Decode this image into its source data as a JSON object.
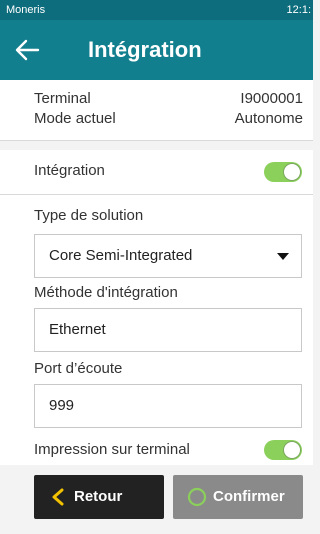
{
  "status_bar": {
    "app_name": "Moneris",
    "time": "12:1:"
  },
  "header": {
    "title": "Intégration",
    "back_icon": "arrow-left-icon"
  },
  "info": {
    "terminal_label": "Terminal",
    "terminal_value": "I9000001",
    "mode_label": "Mode actuel",
    "mode_value": "Autonome"
  },
  "integration_toggle": {
    "label": "Intégration",
    "on": true,
    "color": "#8bd05a"
  },
  "solution_type": {
    "label": "Type de solution",
    "value": "Core Semi-Integrated"
  },
  "integration_method": {
    "label": "Méthode d'intégration",
    "value": "Ethernet"
  },
  "listen_port": {
    "label": "Port d’écoute",
    "value": "999"
  },
  "print_toggle": {
    "label": "Impression sur terminal",
    "on": true
  },
  "buttons": {
    "back_label": "Retour",
    "back_icon": "chevron-left-icon",
    "confirm_label": "Confirmer",
    "confirm_icon": "circle-icon"
  },
  "colors": {
    "header": "#127f8e",
    "status": "#0e6d7d",
    "accent_yellow": "#f2c200"
  }
}
